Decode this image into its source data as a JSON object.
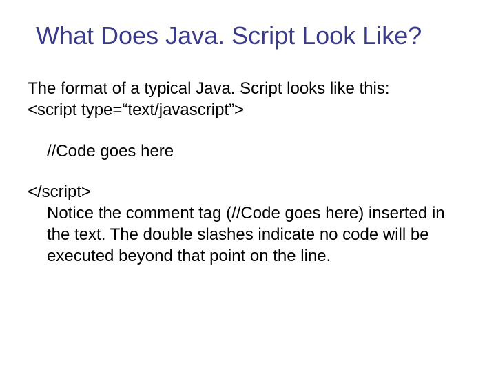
{
  "slide": {
    "title": "What Does Java. Script Look Like?",
    "line1": "The format of a typical Java. Script looks like this:",
    "line2": "<script type=“text/javascript”>",
    "line3": "//Code goes here",
    "line4": "</script>",
    "line5": "Notice the comment tag (//Code goes here) inserted in the text. The double slashes indicate no code will be executed beyond that point on the line."
  }
}
